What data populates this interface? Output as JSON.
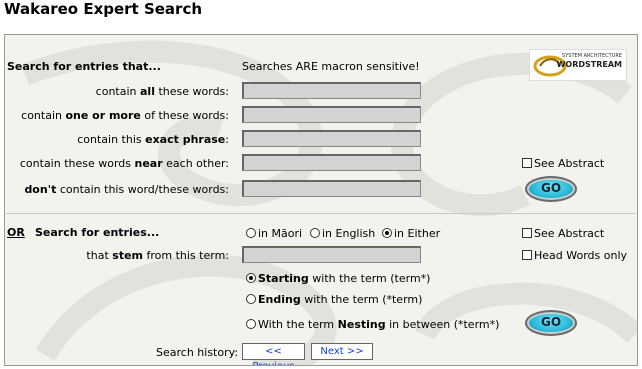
{
  "page_title": "Wakareo Expert Search",
  "logo": {
    "line1": "SYSTEM ARCHITECTURE",
    "line2": "WORDSTREAM"
  },
  "section1": {
    "heading": "Search for entries that...",
    "macron_note": "Searches ARE macron sensitive!",
    "rows": [
      {
        "pre": "contain ",
        "bold": "all",
        "post": " these words:",
        "value": ""
      },
      {
        "pre": "contain ",
        "bold": "one or more",
        "post": " of these words:",
        "value": ""
      },
      {
        "pre": "contain this ",
        "bold": "exact phrase",
        "post": ":",
        "value": ""
      },
      {
        "pre": "contain these words ",
        "bold": "near",
        "post": " each other:",
        "value": ""
      },
      {
        "pre": "",
        "bold": "don't",
        "post": " contain this word/these words:",
        "value": ""
      }
    ],
    "see_abstract": "See Abstract",
    "go": "GO"
  },
  "section2": {
    "or_label": "OR",
    "heading": "Search for entries...",
    "lang_options": [
      "in Māori",
      "in English",
      "in Either"
    ],
    "lang_selected": 2,
    "see_abstract": "See Abstract",
    "head_words": "Head Words only",
    "stem_pre": "that ",
    "stem_bold": "stem",
    "stem_post": " from this term:",
    "stem_value": "",
    "match_options": [
      {
        "bold": "Starting",
        "post": " with the term (term*)"
      },
      {
        "bold": "Ending",
        "post": " with the term (*term)"
      },
      {
        "pre": "With the term ",
        "bold": "Nesting",
        "post": " in between (*term*)"
      }
    ],
    "match_selected": 0,
    "go": "GO"
  },
  "history": {
    "label": "Search history:",
    "previous": "<< Previous",
    "next": "Next >>"
  }
}
